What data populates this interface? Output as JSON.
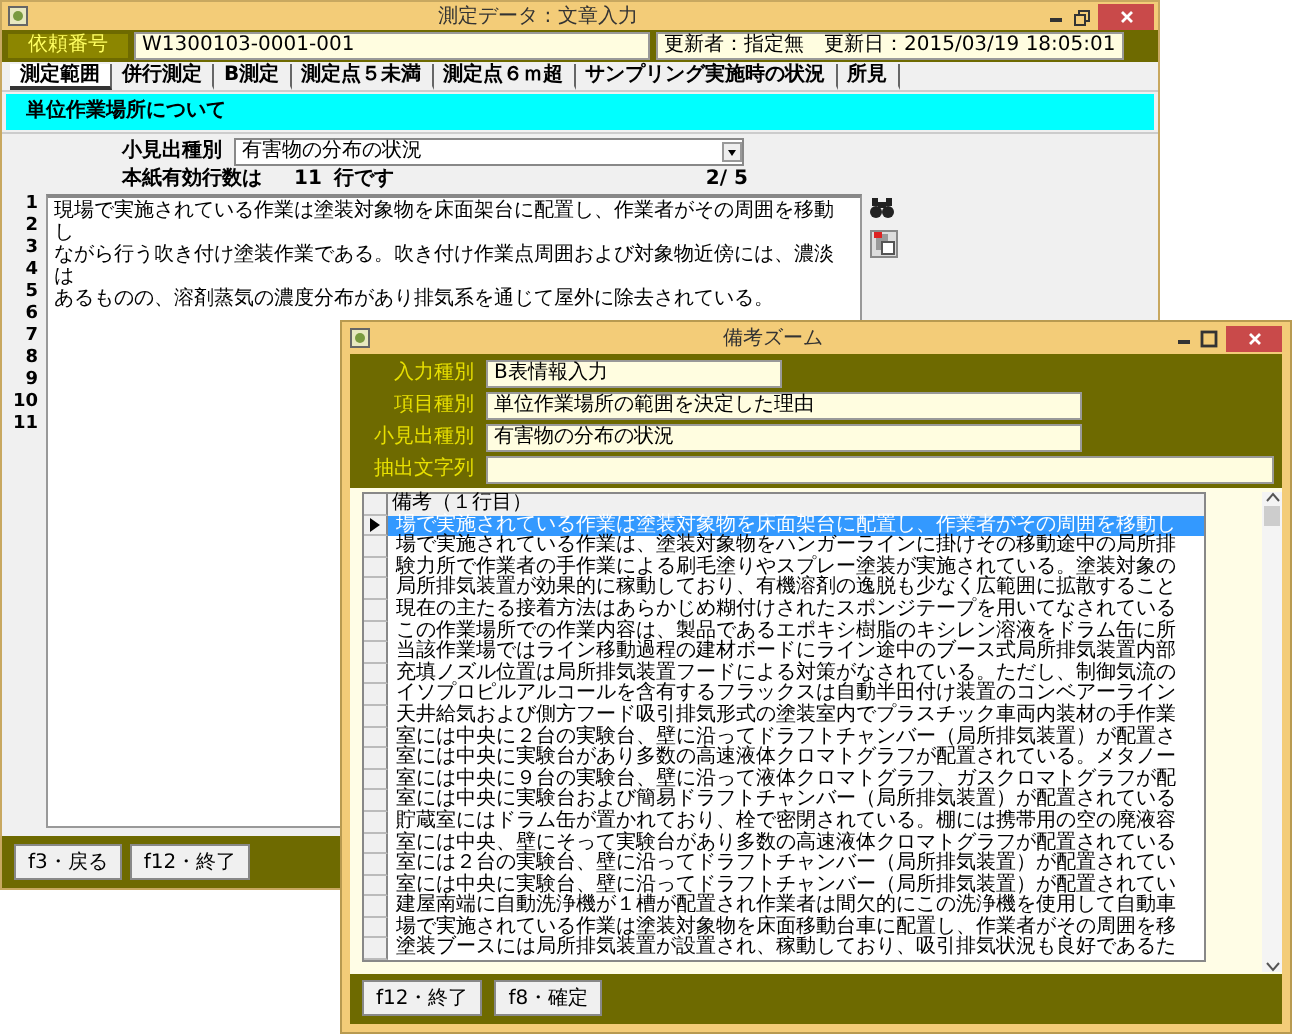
{
  "main_window": {
    "title": "測定データ : 文章入力",
    "request_label": "依頼番号",
    "request_number": "W1300103-0001-001",
    "update_info": "更新者：指定無　更新日：2015/03/19 18:05:01",
    "tabs": [
      {
        "label": "測定範囲",
        "selected": true
      },
      {
        "label": "併行測定",
        "selected": false
      },
      {
        "label": "B測定",
        "selected": false
      },
      {
        "label": "測定点５未満",
        "selected": false
      },
      {
        "label": "測定点６ｍ超",
        "selected": false
      },
      {
        "label": "サンプリング実施時の状況",
        "selected": false
      },
      {
        "label": "所見",
        "selected": false
      }
    ],
    "section_heading": "単位作業場所について",
    "subheading_label": "小見出種別",
    "subheading_value": "有害物の分布の状況",
    "valid_lines_label": "本紙有効行数は",
    "valid_lines_count": "11",
    "valid_lines_unit": "行です",
    "page": "2/ 5",
    "line_numbers": [
      "1",
      "2",
      "3",
      "4",
      "5",
      "6",
      "7",
      "8",
      "9",
      "10",
      "11"
    ],
    "text_lines": [
      "現場で実施されている作業は塗装対象物を床面架台に配置し、作業者がその周囲を移動",
      "し",
      "ながら行う吹き付け塗装作業である。吹き付け作業点周囲および対象物近傍には、濃淡",
      "は",
      "あるものの、溶剤蒸気の濃度分布があり排気系を通じて屋外に除去されている。"
    ],
    "buttons": [
      "f3・戻る",
      "f12・終了"
    ]
  },
  "zoom_window": {
    "title": "備考ズーム",
    "fields": [
      {
        "label": "入力種別",
        "value": "B表情報入力"
      },
      {
        "label": "項目種別",
        "value": "単位作業場所の範囲を決定した理由"
      },
      {
        "label": "小見出種別",
        "value": "有害物の分布の状況"
      },
      {
        "label": "抽出文字列"
      }
    ],
    "grid": {
      "header": "備考（１行目）",
      "rows": [
        {
          "text": "場で実施されている作業は塗装対象物を床面架台に配置し、作業者がその周囲を移動し",
          "selected": true
        },
        {
          "text": "場で実施されている作業は、塗装対象物をハンガーラインに掛けその移動途中の局所排",
          "selected": false
        },
        {
          "text": "験力所で作業者の手作業による刷毛塗りやスプレー塗装が実施されている。塗装対象の",
          "selected": false
        },
        {
          "text": "局所排気装置が効果的に稼動しており、有機溶剤の逸脱も少なく広範囲に拡散すること",
          "selected": false
        },
        {
          "text": "現在の主たる接着方法はあらかじめ糊付けされたスポンジテープを用いてなされている",
          "selected": false
        },
        {
          "text": "この作業場所での作業内容は、製品であるエポキシ樹脂のキシレン溶液をドラム缶に所",
          "selected": false
        },
        {
          "text": "当該作業場ではライン移動過程の建材ボードにライン途中のブース式局所排気装置内部",
          "selected": false
        },
        {
          "text": "充填ノズル位置は局所排気装置フードによる対策がなされている。ただし、制御気流の",
          "selected": false
        },
        {
          "text": "イソプロピルアルコールを含有するフラックスは自動半田付け装置のコンベアーライン",
          "selected": false
        },
        {
          "text": "天井給気および側方フード吸引排気形式の塗装室内でプラスチック車両内装材の手作業",
          "selected": false
        },
        {
          "text": "室には中央に２台の実験台、壁に沿ってドラフトチャンバー（局所排気装置）が配置さ",
          "selected": false
        },
        {
          "text": "室には中央に実験台があり多数の高速液体クロマトグラフが配置されている。メタノー",
          "selected": false
        },
        {
          "text": "室には中央に９台の実験台、壁に沿って液体クロマトグラフ、ガスクロマトグラフが配",
          "selected": false
        },
        {
          "text": "室には中央に実験台および簡易ドラフトチャンバー（局所排気装置）が配置されている",
          "selected": false
        },
        {
          "text": "貯蔵室にはドラム缶が置かれており、栓で密閉されている。棚には携帯用の空の廃液容",
          "selected": false
        },
        {
          "text": "室には中央、壁にそって実験台があり多数の高速液体クロマトグラフが配置されている",
          "selected": false
        },
        {
          "text": "室には２台の実験台、壁に沿ってドラフトチャンバー（局所排気装置）が配置されてい",
          "selected": false
        },
        {
          "text": "室には中央に実験台、壁に沿ってドラフトチャンバー（局所排気装置）が配置されてい",
          "selected": false
        },
        {
          "text": "建屋南端に自動洗浄機が１槽が配置され作業者は間欠的にこの洗浄機を使用して自動車",
          "selected": false
        },
        {
          "text": "場で実施されている作業は塗装対象物を床面移動台車に配置し、作業者がその周囲を移",
          "selected": false
        },
        {
          "text": "塗装ブースには局所排気装置が設置され、稼動しており、吸引排気状況も良好であるた",
          "selected": false
        }
      ]
    },
    "buttons": [
      "f12・終了",
      "f8・確定"
    ]
  }
}
